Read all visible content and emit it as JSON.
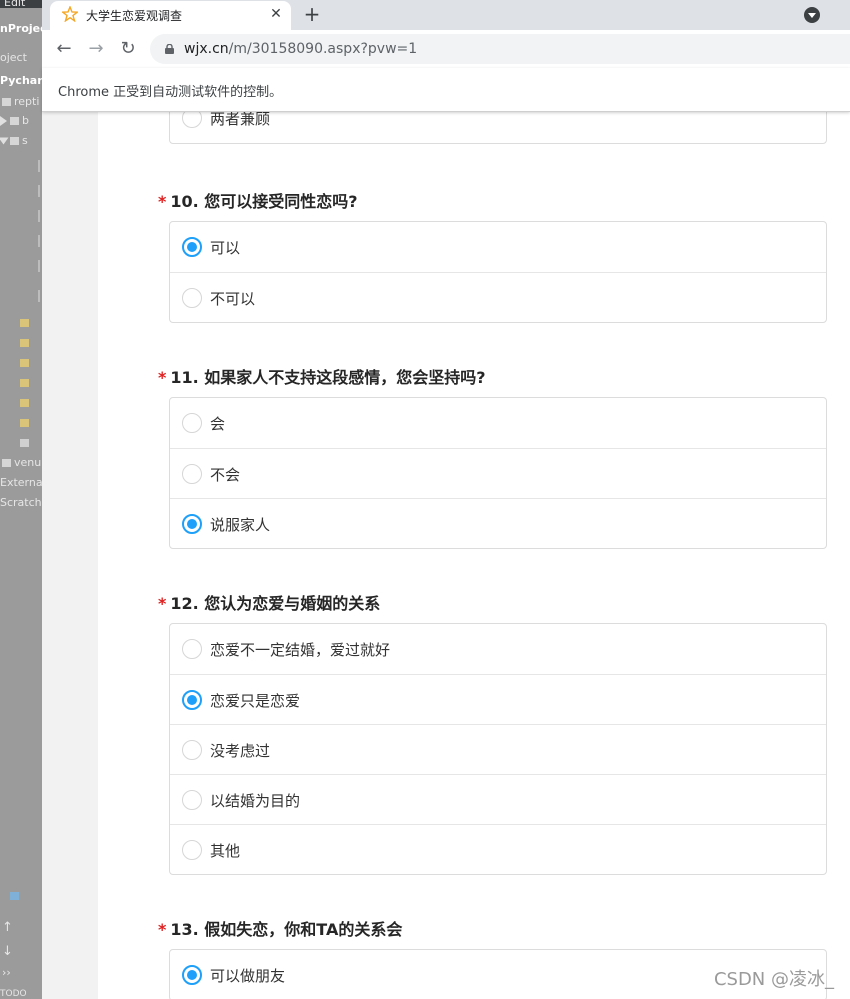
{
  "ide": {
    "labels": [
      "Edit",
      "nProjec",
      "oject",
      "Pychar",
      "repti",
      "b",
      "s",
      "venu",
      "Externa",
      "Scratch",
      "TODO"
    ]
  },
  "browser": {
    "tab_title": "大学生恋爱观调查",
    "close_glyph": "✕",
    "newtab_glyph": "+",
    "url_host": "wjx.cn",
    "url_path": "/m/30158090.aspx?pvw=1",
    "infobar_text": "Chrome 正受到自动测试软件的控制。"
  },
  "survey": {
    "prev_question_last_option": "两者兼顾",
    "questions": [
      {
        "number": "10.",
        "title": "您可以接受同性恋吗?",
        "options": [
          {
            "label": "可以",
            "checked": true
          },
          {
            "label": "不可以",
            "checked": false
          }
        ]
      },
      {
        "number": "11.",
        "title": "如果家人不支持这段感情，您会坚持吗?",
        "options": [
          {
            "label": "会",
            "checked": false
          },
          {
            "label": "不会",
            "checked": false
          },
          {
            "label": "说服家人",
            "checked": true
          }
        ]
      },
      {
        "number": "12.",
        "title": "您认为恋爱与婚姻的关系",
        "options": [
          {
            "label": "恋爱不一定结婚，爱过就好",
            "checked": false
          },
          {
            "label": "恋爱只是恋爱",
            "checked": true
          },
          {
            "label": "没考虑过",
            "checked": false
          },
          {
            "label": "以结婚为目的",
            "checked": false
          },
          {
            "label": "其他",
            "checked": false
          }
        ]
      },
      {
        "number": "13.",
        "title": "假如失恋，你和TA的关系会",
        "options": [
          {
            "label": "可以做朋友",
            "checked": true
          }
        ]
      }
    ],
    "required_mark": "*"
  },
  "watermark": "CSDN @凌冰_",
  "colors": {
    "accent": "#1ea0fa",
    "required": "#e02020"
  }
}
